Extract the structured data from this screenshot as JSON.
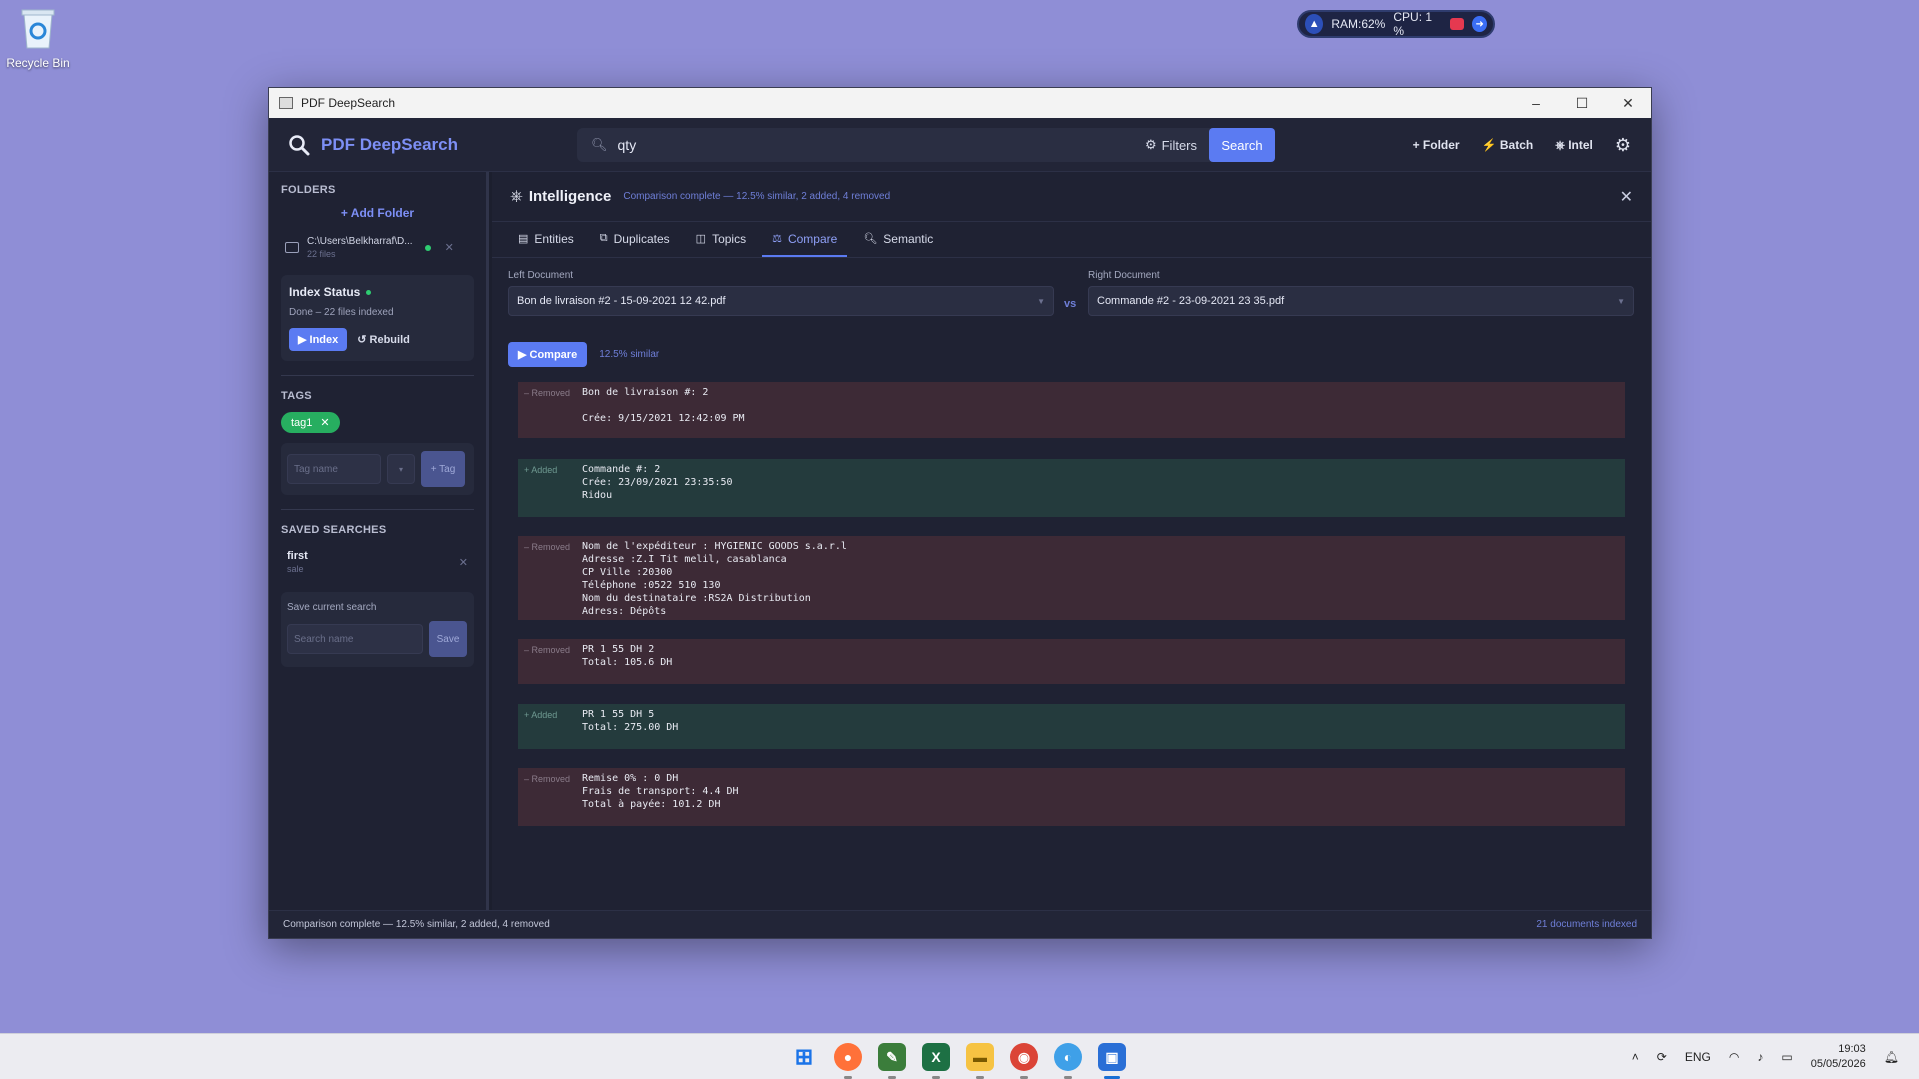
{
  "desktop": {
    "recycle_bin": "Recycle Bin"
  },
  "sysmon": {
    "ram": "RAM:62%",
    "cpu": "CPU: 1 %"
  },
  "window": {
    "title": "PDF DeepSearch"
  },
  "header": {
    "brand": "PDF DeepSearch",
    "search_value": "qty",
    "filters": "Filters",
    "search_button": "Search",
    "add_folder": "+ Folder",
    "batch": "Batch",
    "intel": "Intel"
  },
  "sidebar": {
    "folders_title": "FOLDERS",
    "add_folder": "+ Add Folder",
    "folder_path": "C:\\Users\\Belkharraf\\D...",
    "folder_count": "22 files",
    "index_title": "Index Status",
    "index_status": "Done – 22 files indexed",
    "index_button": "▶ Index",
    "rebuild_button": "↺ Rebuild",
    "tags_title": "TAGS",
    "tag1": "tag1",
    "tag_name_placeholder": "Tag name",
    "tag_button": "+ Tag",
    "saved_title": "SAVED SEARCHES",
    "saved_name": "first",
    "saved_query": "sale",
    "save_label": "Save current search",
    "search_name_placeholder": "Search name",
    "save_button": "Save"
  },
  "intel": {
    "title": "Intelligence",
    "status": "Comparison complete — 12.5% similar, 2 added, 4 removed",
    "tabs": [
      "Entities",
      "Duplicates",
      "Topics",
      "Compare",
      "Semantic"
    ],
    "left_label": "Left Document",
    "right_label": "Right Document",
    "left_doc": "Bon de livraison #2 - 15-09-2021 12 42.pdf",
    "right_doc": "Commande #2 - 23-09-2021 23 35.pdf",
    "vs": "vs",
    "compare_button": "▶ Compare",
    "similarity": "12.5% similar"
  },
  "diffs": [
    {
      "kind": "removed",
      "label": "– Removed",
      "text": "Bon de livraison #: 2\n\nCrée: 9/15/2021 12:42:09 PM"
    },
    {
      "kind": "added",
      "label": "+ Added",
      "text": "Commande #: 2\nCrée: 23/09/2021 23:35:50\nRidou"
    },
    {
      "kind": "removed",
      "label": "– Removed",
      "text": "Nom de l'expéditeur : HYGIENIC GOODS s.a.r.l\nAdresse :Z.I Tit melil, casablanca\nCP Ville :20300\nTéléphone :0522 510 130\nNom du destinataire :RS2A Distribution\nAdress: Dépôts"
    },
    {
      "kind": "removed",
      "label": "– Removed",
      "text": "PR 1 55 DH 2\nTotal: 105.6 DH"
    },
    {
      "kind": "added",
      "label": "+ Added",
      "text": "PR 1 55 DH 5\nTotal: 275.00 DH"
    },
    {
      "kind": "removed",
      "label": "– Removed",
      "text": "Remise 0% : 0 DH\nFrais de transport: 4.4 DH\nTotal à payée: 101.2 DH"
    }
  ],
  "statusbar": {
    "left": "Comparison complete — 12.5% similar, 2 added, 4 removed",
    "right": "21 documents indexed"
  },
  "taskbar": {
    "lang": "ENG",
    "time": "19:03",
    "date": "05/05/2026"
  }
}
